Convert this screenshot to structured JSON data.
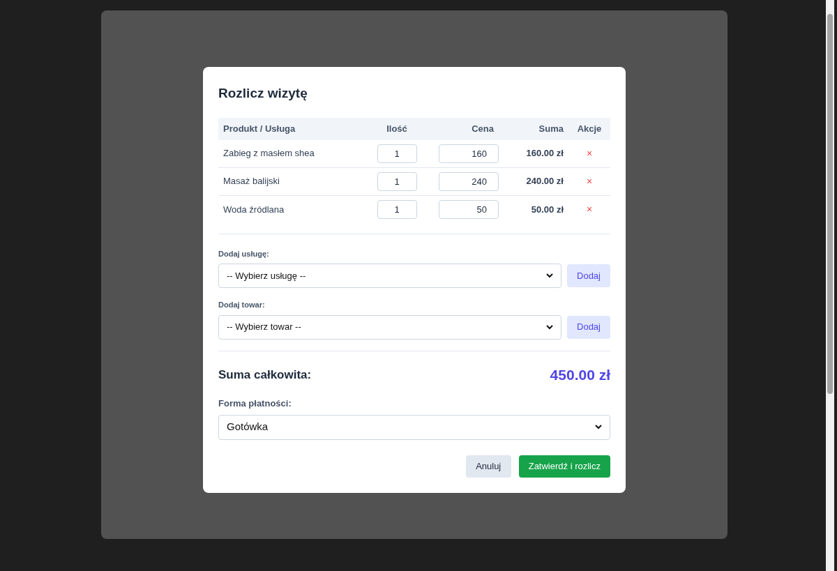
{
  "dialog": {
    "title": "Rozlicz wizytę",
    "table": {
      "columns": [
        "Produkt / Usługa",
        "Ilość",
        "Cena",
        "Suma",
        "Akcje"
      ],
      "rows": [
        {
          "name": "Zabieg z masłem shea",
          "quantity": "1",
          "price": "160",
          "total": "160.00 zł",
          "remove": "×"
        },
        {
          "name": "Masaż balijski",
          "quantity": "1",
          "price": "240",
          "total": "240.00 zł",
          "remove": "×"
        },
        {
          "name": "Woda źródlana",
          "quantity": "1",
          "price": "50",
          "total": "50.00 zł",
          "remove": "×"
        }
      ]
    },
    "add_sections": [
      {
        "label": "Dodaj usługę:",
        "select": "-- Wybierz usługę --",
        "button": "Dodaj"
      },
      {
        "label": "Dodaj towar:",
        "select": "-- Wybierz towar --",
        "button": "Dodaj"
      }
    ],
    "total_label": "Suma całkowita:",
    "total_value": "450.00 zł",
    "payment": {
      "label": "Forma płatności:",
      "value": "Gotówka"
    },
    "buttons": [
      {
        "label": "Anuluj",
        "kind": "secondary"
      },
      {
        "label": "Zatwierdź i rozlicz",
        "kind": "primary"
      }
    ]
  }
}
